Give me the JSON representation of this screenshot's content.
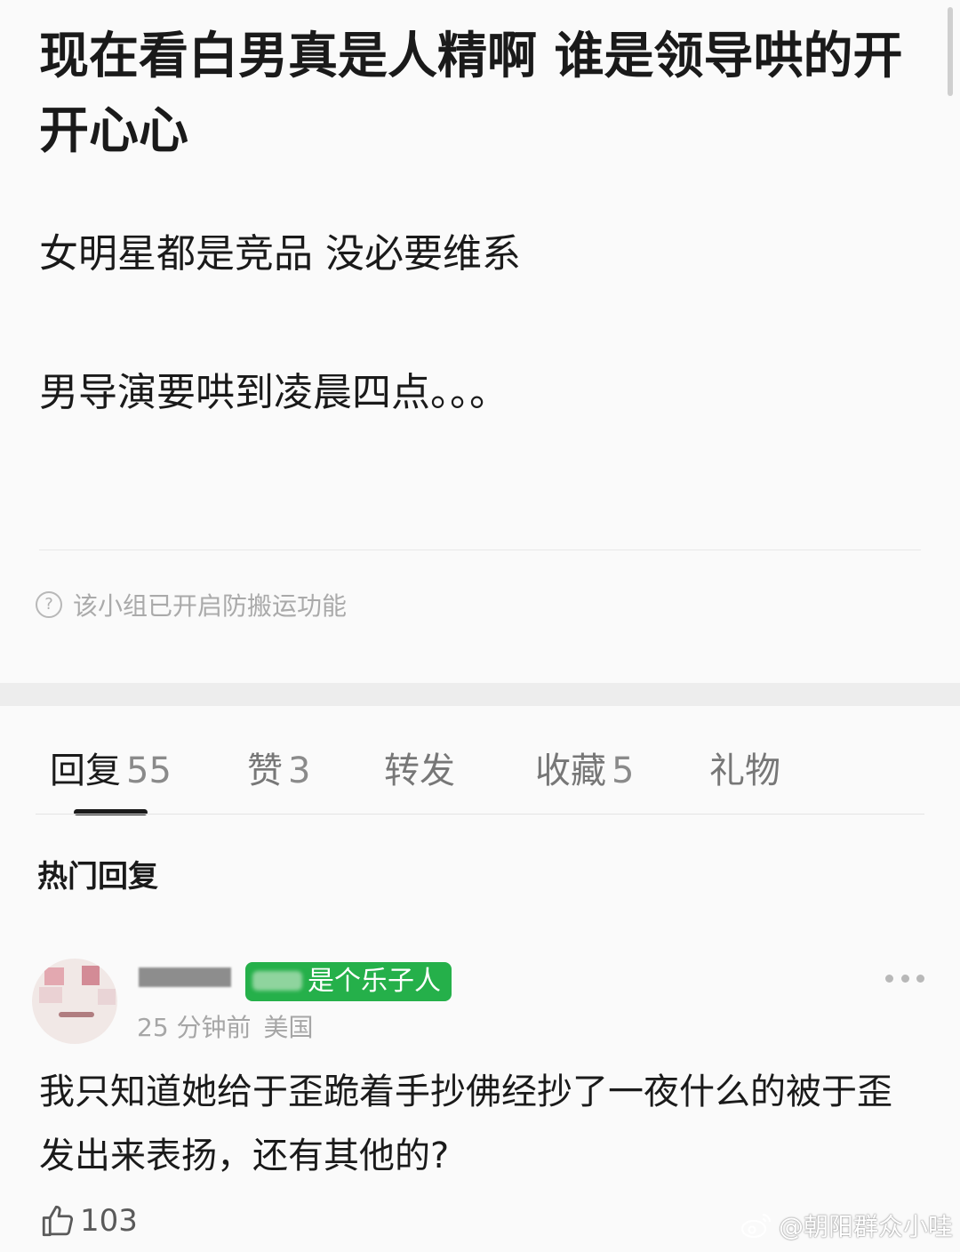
{
  "post": {
    "title": "现在看白男真是人精啊 谁是领导哄的开开心心",
    "paragraphs": [
      "女明星都是竞品 没必要维系",
      "男导演要哄到凌晨四点。。。"
    ],
    "notice": "该小组已开启防搬运功能",
    "notice_icon": "question-circle-icon"
  },
  "tabs": [
    {
      "label": "回复",
      "count": "55",
      "active": true
    },
    {
      "label": "赞",
      "count": "3",
      "active": false
    },
    {
      "label": "转发",
      "count": "",
      "active": false
    },
    {
      "label": "收藏",
      "count": "5",
      "active": false
    },
    {
      "label": "礼物",
      "count": "",
      "active": false
    }
  ],
  "section_title": "热门回复",
  "reply": {
    "badge": "是个乐子人",
    "time": "25 分钟前",
    "location": "美国",
    "text": "我只知道她给于歪跪着手抄佛经抄了一夜什么的被于歪发出来表扬，还有其他的?",
    "likes": "103",
    "like_icon": "thumbs-up-icon",
    "more_icon": "more-dots-icon"
  },
  "watermark": {
    "text": "@朝阳群众小哇",
    "icon": "weibo-logo-icon"
  },
  "colors": {
    "badge": "#25b04a",
    "muted": "#a6a6a6",
    "text": "#1a1a1a"
  }
}
